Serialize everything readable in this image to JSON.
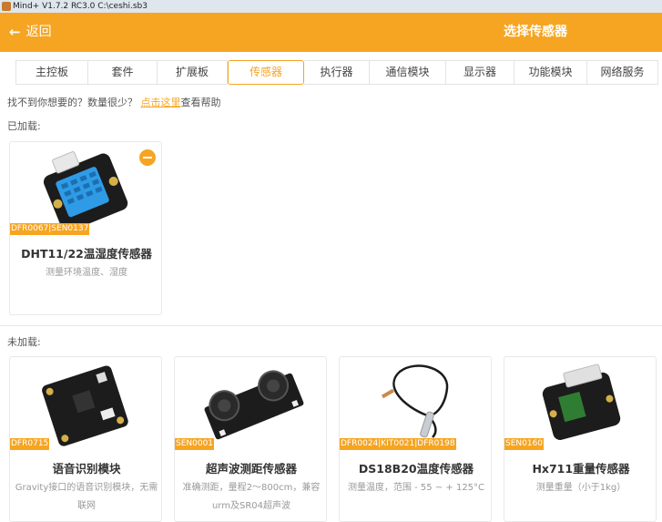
{
  "window": {
    "title": "Mind+ V1.7.2 RC3.0  C:\\ceshi.sb3"
  },
  "header": {
    "back_label": "返回",
    "title": "选择传感器"
  },
  "tabs": [
    {
      "label": "主控板"
    },
    {
      "label": "套件"
    },
    {
      "label": "扩展板"
    },
    {
      "label": "传感器",
      "active": true
    },
    {
      "label": "执行器"
    },
    {
      "label": "通信模块"
    },
    {
      "label": "显示器"
    },
    {
      "label": "功能模块"
    },
    {
      "label": "网络服务"
    }
  ],
  "help": {
    "prefix": "找不到你想要的？数量很少？ ",
    "link": "点击这里",
    "suffix": "查看帮助"
  },
  "loaded": {
    "label": "已加载:",
    "items": [
      {
        "code": "DFR0067|SEN0137",
        "name": "DHT11/22温湿度传感器",
        "desc": "测量环境温度、湿度"
      }
    ]
  },
  "unloaded": {
    "label": "未加载:",
    "items": [
      {
        "code": "DFR0715",
        "name": "语音识别模块",
        "desc": "Gravity接口的语音识别模块，无需联网"
      },
      {
        "code": "SEN0001",
        "name": "超声波测距传感器",
        "desc": "准确测距，量程2～800cm，兼容urm及SR04超声波"
      },
      {
        "code": "DFR0024|KIT0021|DFR0198",
        "name": "DS18B20温度传感器",
        "desc": "测量温度，范围 - 55 ~ + 125°C"
      },
      {
        "code": "SEN0160",
        "name": "Hx711重量传感器",
        "desc": "测量重量（小于1kg）"
      }
    ]
  },
  "colors": {
    "accent": "#f6a522",
    "module_black": "#1c1c1c",
    "dht_blue": "#2f9be6"
  }
}
